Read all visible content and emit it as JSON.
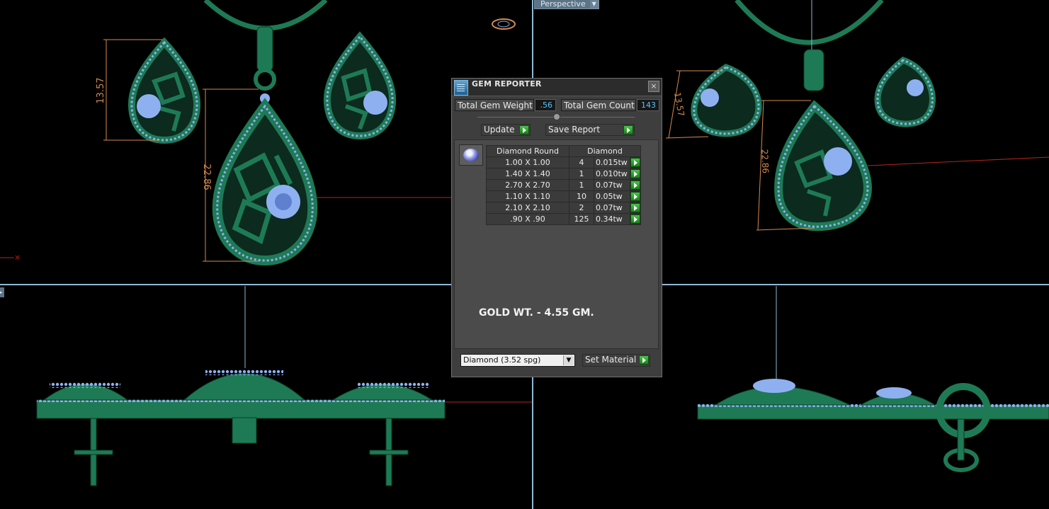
{
  "viewport": {
    "perspective_label": "Perspective",
    "dimensions": {
      "front_earring_height": "13.57",
      "front_pendant_height": "22.86",
      "persp_earring_height": "13.57",
      "persp_pendant_height": "22.86"
    },
    "axis_marker": "×"
  },
  "dialog": {
    "title": "GEM REPORTER",
    "close_glyph": "×",
    "total_gem_weight_label": "Total Gem Weight",
    "total_gem_weight_value": ".56",
    "total_gem_count_label": "Total Gem Count",
    "total_gem_count_value": "143",
    "update_label": "Update",
    "save_report_label": "Save Report",
    "table": {
      "headers": [
        "Diamond Round",
        "Diamond"
      ],
      "rows": [
        {
          "size": "1.00 X 1.00",
          "count": "4",
          "weight": "0.015tw"
        },
        {
          "size": "1.40 X 1.40",
          "count": "1",
          "weight": "0.010tw"
        },
        {
          "size": "2.70 X 2.70",
          "count": "1",
          "weight": "0.07tw"
        },
        {
          "size": "1.10 X 1.10",
          "count": "10",
          "weight": "0.05tw"
        },
        {
          "size": "2.10 X 2.10",
          "count": "2",
          "weight": "0.07tw"
        },
        {
          "size": ".90 X .90",
          "count": "125",
          "weight": "0.34tw"
        }
      ]
    },
    "gold_note": "GOLD WT. - 4.55 GM.",
    "material_select": "Diamond     (3.52 spg)",
    "set_material_label": "Set Material"
  },
  "colors": {
    "metal": "#1e7a55",
    "metal_edge": "#0b3d27",
    "gem": "#8fb0f0",
    "dimension": "#d48a4e",
    "divider": "#8fb9d6",
    "red_axis": "#b3261e"
  }
}
